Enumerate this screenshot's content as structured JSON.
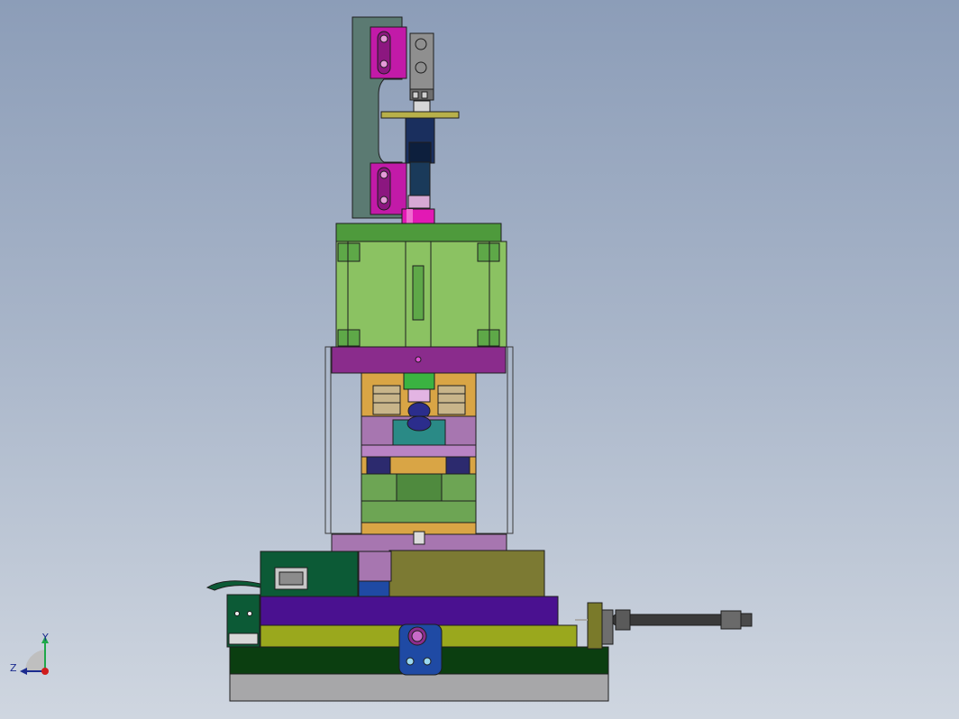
{
  "view": {
    "background_top": "#8c9db8",
    "background_bottom": "#cfd6e0",
    "triad": {
      "y_label": "Y",
      "z_label": "Z"
    }
  },
  "parts": [
    {
      "name": "backing-plate",
      "color": "#5b7a72"
    },
    {
      "name": "magenta-clamp-block",
      "color": "#c21aa8"
    },
    {
      "name": "pneumatic-cylinder-body",
      "color": "#1a2f5e"
    },
    {
      "name": "magenta-coupling",
      "color": "#e219b4"
    },
    {
      "name": "green-guide-block",
      "color": "#8bc262"
    },
    {
      "name": "purple-top-plate",
      "color": "#8a2c8c"
    },
    {
      "name": "orange-die-plate",
      "color": "#d9a545"
    },
    {
      "name": "violet-stripper-plate",
      "color": "#a776b0"
    },
    {
      "name": "olive-lower-block",
      "color": "#7c7a33"
    },
    {
      "name": "dark-green-side-box",
      "color": "#0c5a36"
    },
    {
      "name": "purple-base-plate",
      "color": "#4a1190"
    },
    {
      "name": "yellow-green-base-plate",
      "color": "#9aa81d"
    },
    {
      "name": "dark-green-base-plate",
      "color": "#0b3e10"
    },
    {
      "name": "gray-bottom-plate",
      "color": "#a7a7a9"
    },
    {
      "name": "blue-locating-block",
      "color": "#1f4aa4"
    },
    {
      "name": "side-air-cylinder",
      "color": "#3a3a3a"
    }
  ]
}
